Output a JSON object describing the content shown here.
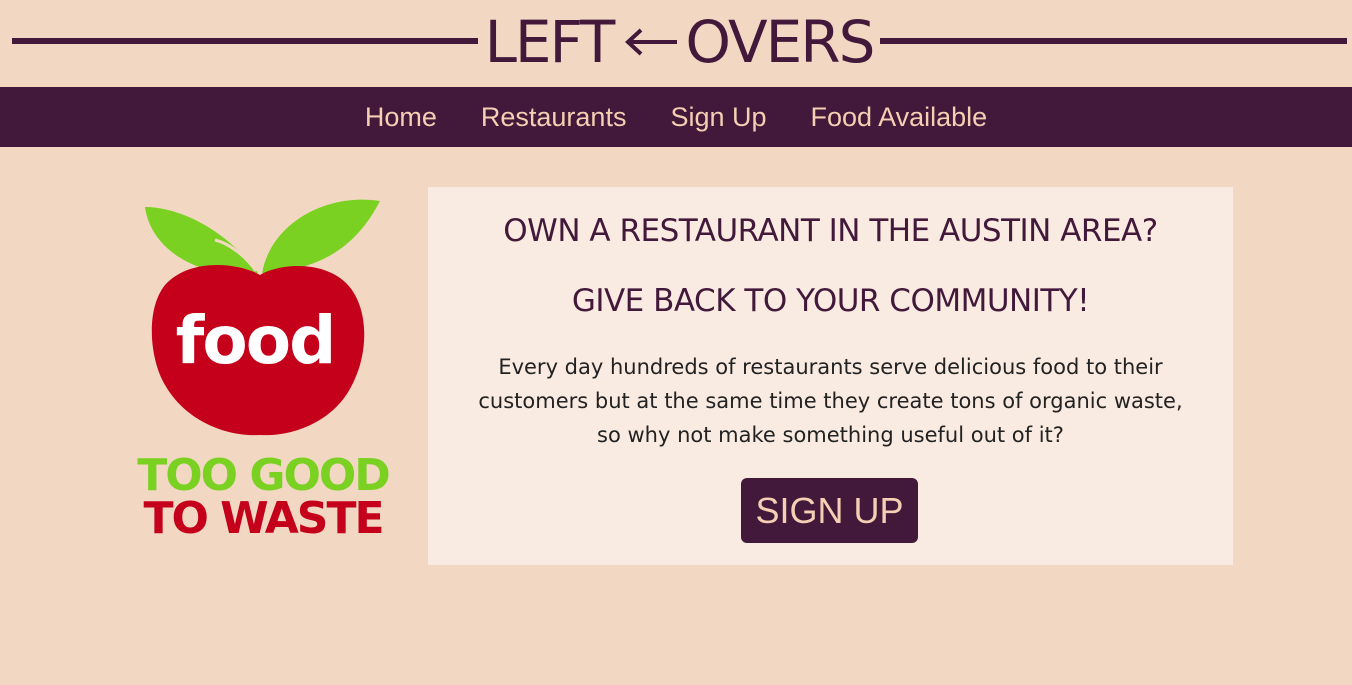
{
  "header": {
    "brand_left": "LEFT",
    "brand_right": "OVERS"
  },
  "nav": {
    "items": [
      {
        "label": "Home"
      },
      {
        "label": "Restaurants"
      },
      {
        "label": "Sign Up"
      },
      {
        "label": "Food Available"
      }
    ]
  },
  "logo": {
    "word": "food",
    "line1": "TOO GOOD",
    "line2": "TO WASTE"
  },
  "card": {
    "heading1": "OWN A RESTAURANT IN THE AUSTIN AREA?",
    "heading2": "GIVE BACK TO YOUR COMMUNITY!",
    "body_lines": [
      "Every day hundreds of restaurants serve delicious food to their",
      "customers but at the same time they create tons of organic waste,",
      "so why not make something useful out of it?"
    ],
    "button_label": "SIGN UP"
  },
  "colors": {
    "page_bg": "#f2d8c3",
    "primary": "#42193a",
    "nav_text": "#f5cfb3",
    "card_bg": "#f9ebe1",
    "logo_red": "#c4001a",
    "logo_green": "#7ad122"
  }
}
